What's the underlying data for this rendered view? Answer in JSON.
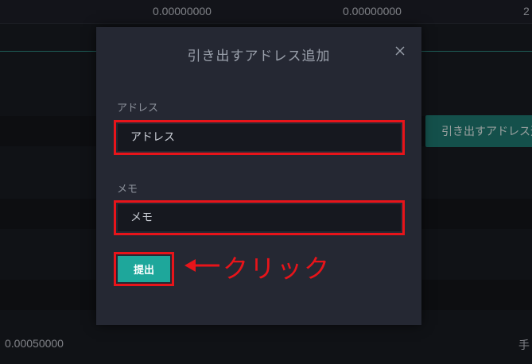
{
  "background": {
    "top_values": [
      "0.00000000",
      "0.00000000",
      "2"
    ],
    "withdraw_button_label": "引き出すアドレス追",
    "bottom_left_value": "0.00050000",
    "bottom_right_text": "手"
  },
  "modal": {
    "title": "引き出すアドレス追加",
    "close_icon": "close-icon",
    "address": {
      "label": "アドレス",
      "placeholder": "アドレス"
    },
    "memo": {
      "label": "メモ",
      "placeholder": "メモ"
    },
    "submit_label": "提出"
  },
  "annotation": {
    "text": "クリック",
    "color": "#e8141a",
    "arrow_icon": "left-arrow-icon"
  },
  "colors": {
    "accent": "#1ea79b",
    "highlight": "#e8141a",
    "modal_bg": "#252833"
  }
}
